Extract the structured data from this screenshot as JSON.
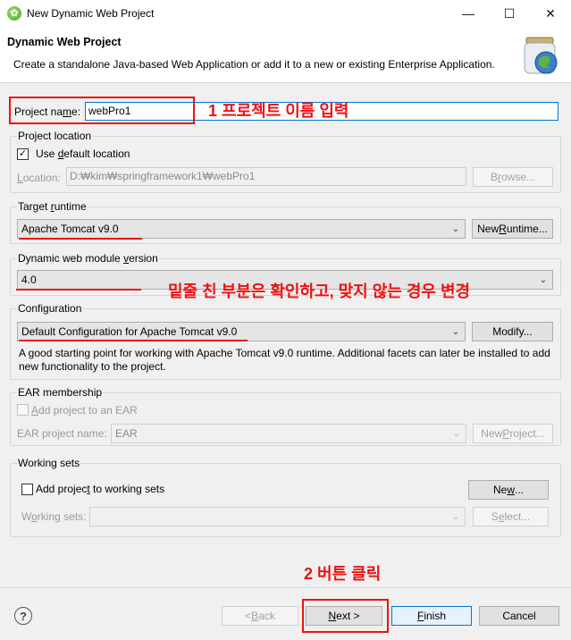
{
  "window": {
    "title": "New Dynamic Web Project",
    "minimize_icon": "minimize-icon",
    "maximize_icon": "maximize-icon",
    "close_icon": "close-icon"
  },
  "banner": {
    "title": "Dynamic Web Project",
    "description": "Create a standalone Java-based Web Application or add it to a new or existing Enterprise Application."
  },
  "project_name": {
    "label": "Project name:",
    "value": "webPro1"
  },
  "project_location": {
    "group_label": "Project location",
    "use_default_label": "Use default location",
    "use_default_checked": true,
    "location_label": "Location:",
    "location_value": "D:₩kim₩springframework1₩webPro1",
    "browse_label": "Browse..."
  },
  "target_runtime": {
    "group_label": "Target runtime",
    "value": "Apache Tomcat v9.0",
    "new_runtime_label": "New Runtime..."
  },
  "module_version": {
    "group_label": "Dynamic web module version",
    "value": "4.0"
  },
  "configuration": {
    "group_label": "Configuration",
    "value": "Default Configuration for Apache Tomcat v9.0",
    "modify_label": "Modify...",
    "description": "A good starting point for working with Apache Tomcat v9.0 runtime. Additional facets can later be installed to add new functionality to the project."
  },
  "ear": {
    "group_label": "EAR membership",
    "add_label": "Add project to an EAR",
    "project_name_label": "EAR project name:",
    "project_name_value": "EAR",
    "new_project_label": "New Project..."
  },
  "working_sets": {
    "group_label": "Working sets",
    "add_label": "Add project to working sets",
    "new_label": "New...",
    "sets_label": "Working sets:",
    "select_label": "Select..."
  },
  "annotations": {
    "step1": "1 프로젝트 이름 입력",
    "underline_note": "밑줄 친 부분은 확인하고, 맞지 않는 경우 변경",
    "step2": "2 버튼 클릭",
    "color": "#e11111"
  },
  "footer": {
    "help_icon": "help-icon",
    "help_symbol": "?",
    "back_label": "< Back",
    "next_label": "Next >",
    "finish_label": "Finish",
    "cancel_label": "Cancel"
  }
}
